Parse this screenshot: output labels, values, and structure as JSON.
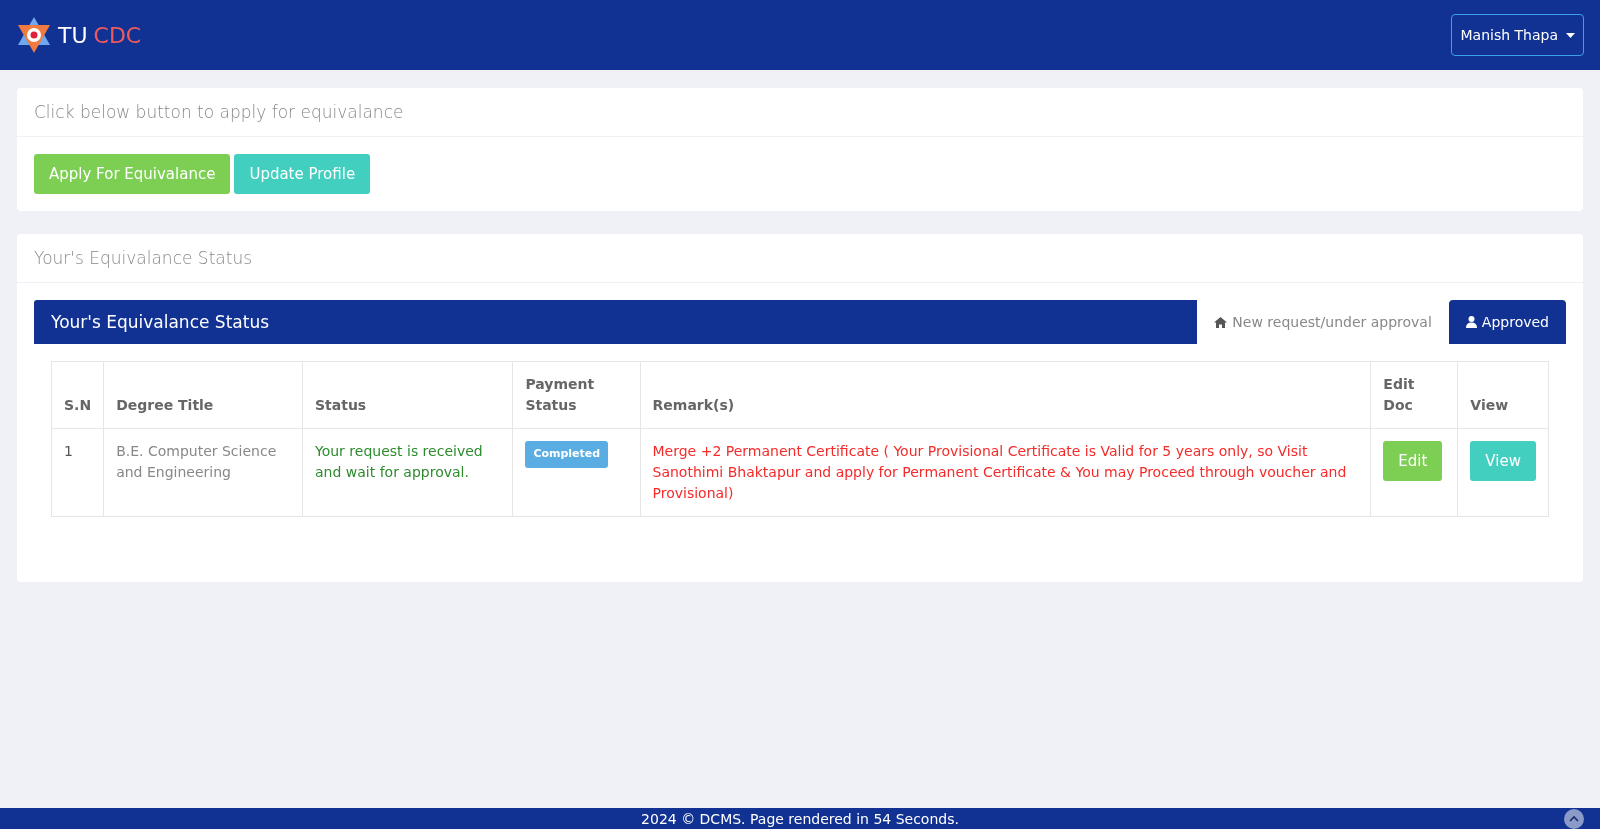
{
  "navbar": {
    "brand_main": "TU",
    "brand_accent": "CDC",
    "user_menu": "Manish Thapa"
  },
  "apply_card": {
    "heading": "Click below button to apply for equivalance",
    "buttons": [
      {
        "label": "Apply For Equivalance",
        "kind": "success"
      },
      {
        "label": "Update Profile",
        "kind": "info"
      }
    ]
  },
  "status_card": {
    "heading": "Your's Equivalance Status",
    "panel_title": "Your's Equivalance Status",
    "tabs": [
      {
        "label": "New request/under approval",
        "kind": "home",
        "selected": true
      },
      {
        "label": "Approved",
        "kind": "user",
        "selected": false
      }
    ],
    "table": {
      "columns": [
        "S.N",
        "Degree Title",
        "Status",
        "Payment Status",
        "Remark(s)",
        "Edit Doc",
        "View"
      ],
      "rows": [
        {
          "sn": "1",
          "degree": "B.E. Computer Science and Engineering",
          "status": "Your request is received and wait for approval.",
          "payment": "Completed",
          "remark": "Merge +2 Permanent Certificate ( Your Provisional Certificate is Valid for 5 years only, so Visit Sanothimi Bhaktapur and apply for Permanent Certificate & You may Proceed through voucher and Provisional)",
          "edit": "Edit",
          "view": "View"
        }
      ]
    }
  },
  "footer": {
    "text": "2024 © DCMS. Page rendered in 54 Seconds."
  }
}
